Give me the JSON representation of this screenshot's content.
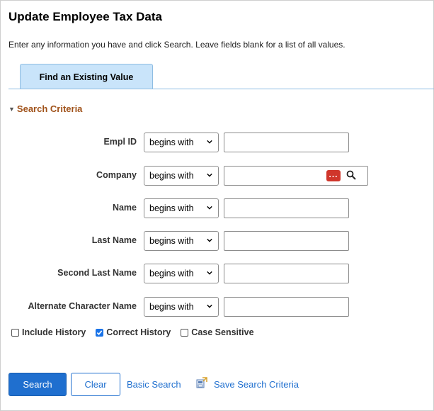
{
  "page": {
    "title": "Update Employee Tax Data",
    "instructions": "Enter any information you have and click Search. Leave fields blank for a list of all values."
  },
  "tab": {
    "label": "Find an Existing Value"
  },
  "section": {
    "label": "Search Criteria"
  },
  "fields": [
    {
      "label": "Empl ID",
      "operator": "begins with",
      "value": ""
    },
    {
      "label": "Company",
      "operator": "begins with",
      "value": ""
    },
    {
      "label": "Name",
      "operator": "begins with",
      "value": ""
    },
    {
      "label": "Last Name",
      "operator": "begins with",
      "value": ""
    },
    {
      "label": "Second Last Name",
      "operator": "begins with",
      "value": ""
    },
    {
      "label": "Alternate Character Name",
      "operator": "begins with",
      "value": ""
    }
  ],
  "options": [
    {
      "label": "Include History",
      "checked": false
    },
    {
      "label": "Correct History",
      "checked": true
    },
    {
      "label": "Case Sensitive",
      "checked": false
    }
  ],
  "buttons": {
    "search": "Search",
    "clear": "Clear",
    "basic_search": "Basic Search",
    "save_criteria": "Save Search Criteria"
  },
  "icons": {
    "lookup": "ellipsis-lookup-icon",
    "search": "magnifier-icon",
    "save": "save-criteria-icon"
  },
  "colors": {
    "primary": "#1f6fcf",
    "tab_bg": "#c9e4fa",
    "section_heading": "#a0521a",
    "lookup_button": "#d0362b"
  }
}
